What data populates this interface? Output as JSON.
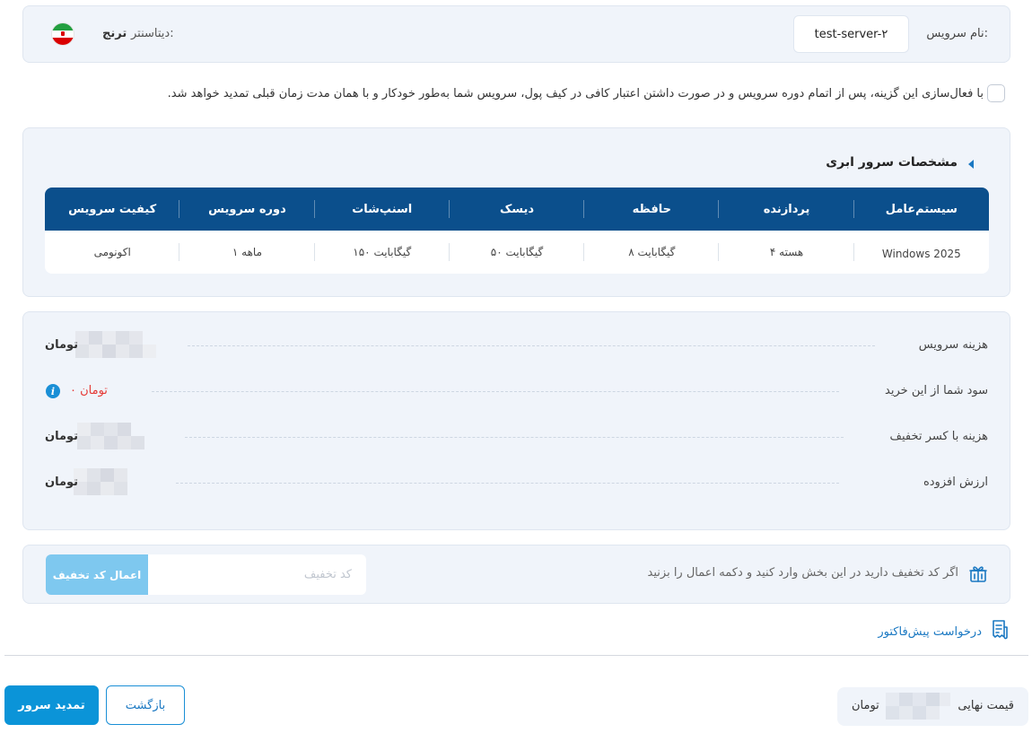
{
  "service": {
    "name_label": "نام سرویس:",
    "name_value": "test-server-۲",
    "datacenter_label": "دیتاسنتر:",
    "datacenter_value": "ترنج",
    "flag_icon": "iran-flag-icon"
  },
  "auto_renew": {
    "text": "با فعال‌سازی این گزینه، پس از اتمام دوره سرویس و در صورت داشتن اعتبار کافی در کیف پول، سرویس شما به‌طور خودکار و با همان مدت زمان قبلی تمدید خواهد شد.",
    "checked": false
  },
  "specs": {
    "title": "مشخصات سرور ابری",
    "headers": [
      "سیستم‌عامل",
      "پردازنده",
      "حافظه",
      "دیسک",
      "اسنپ‌شات",
      "دوره سرویس",
      "کیفیت سرویس"
    ],
    "values": [
      "Windows 2025",
      "۴ هسته",
      "۸ گیگابایت",
      "۵۰ گیگابایت",
      "۱۵۰ گیگابایت",
      "۱ ماهه",
      "اکونومی"
    ]
  },
  "costs": {
    "service_cost_label": "هزینه سرویس",
    "service_cost_value": "تومان",
    "profit_label": "سود شما از این خرید",
    "profit_value": "۰ تومان",
    "discounted_cost_label": "هزینه با کسر تخفیف",
    "discounted_cost_value": "تومان",
    "vat_label": "ارزش افزوده",
    "vat_value": "تومان"
  },
  "discount": {
    "hint": "اگر کد تخفیف دارید در این بخش وارد کنید و دکمه اعمال را بزنید",
    "placeholder": "کد تخفیف",
    "apply_label": "اعمال کد تخفیف",
    "input_value": ""
  },
  "proforma": {
    "label": "درخواست پیش‌فاکتور"
  },
  "footer": {
    "final_price_label": "قیمت نهایی",
    "final_price_value": "تومان",
    "back_label": "بازگشت",
    "renew_label": "تمدید سرور"
  },
  "colors": {
    "accent": "#0b94d8",
    "table_header": "#0b4f8c",
    "card_bg": "#f0f4fa",
    "profit_red": "#e53935",
    "apply_disabled": "#7ec8ef"
  }
}
